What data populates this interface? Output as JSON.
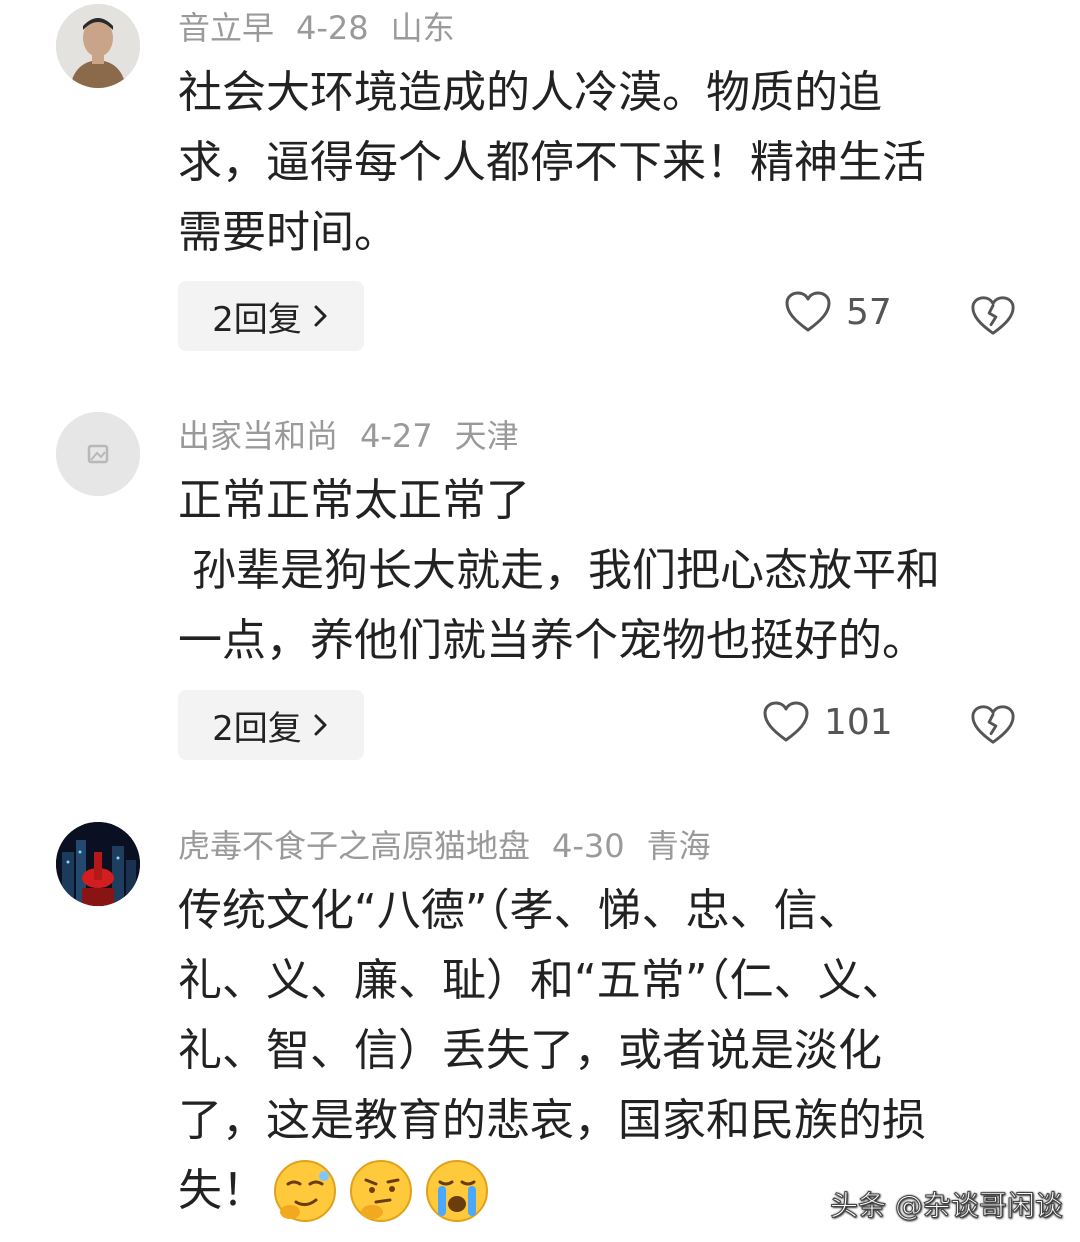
{
  "comments": [
    {
      "username": "音立早",
      "date": "4-28",
      "location": "山东",
      "text": "社会大环境造成的人冷漠。物质的追\n求，逼得每个人都停不下来！精神生活\n需要时间。",
      "reply_label": "2回复",
      "likes": "57",
      "avatar_icon": "user-photo-avatar"
    },
    {
      "username": "出家当和尚",
      "date": "4-27",
      "location": "天津",
      "text": "正常正常太正常了\n 孙辈是狗长大就走，我们把心态放平和\n一点，养他们就当养个宠物也挺好的。",
      "reply_label": "2回复",
      "likes": "101",
      "avatar_icon": "image-placeholder-icon"
    },
    {
      "username": "虎毒不食子之高原猫地盘",
      "date": "4-30",
      "location": "青海",
      "text": "传统文化“八德”（孝、悌、忠、信、\n礼、义、廉、耻）和“五常”（仁、义、\n礼、智、信）丢失了，或者说是淡化\n了，这是教育的悲哀，国家和民族的损\n失！",
      "emojis": [
        "smug-face-emoji",
        "thinking-face-emoji",
        "crying-face-emoji"
      ],
      "avatar_icon": "city-night-avatar"
    }
  ],
  "watermark": "头条 @杂谈哥闲谈",
  "colors": {
    "meta_text": "#9a9a9a",
    "body_text": "#222222",
    "reply_bg": "#f3f3f3"
  }
}
